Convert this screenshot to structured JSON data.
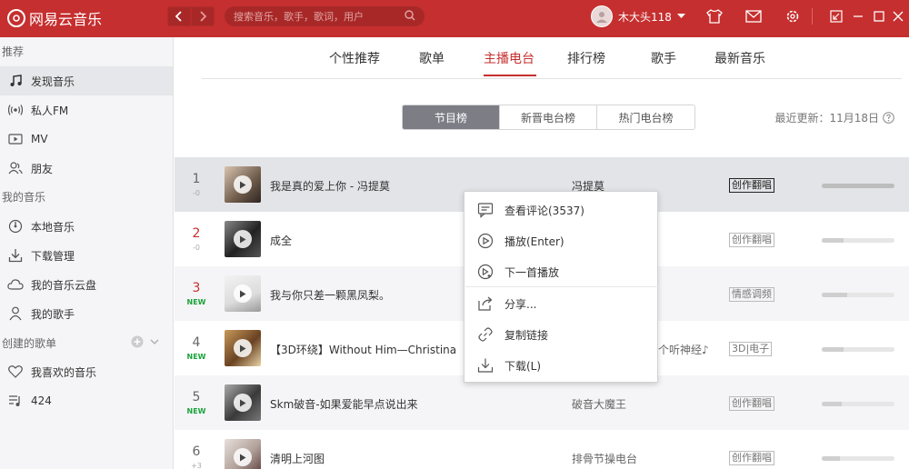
{
  "app": {
    "logo_text": "网易云音乐"
  },
  "search": {
    "placeholder": "搜索音乐，歌手，歌词，用户"
  },
  "user": {
    "name": "木大头118"
  },
  "sidebar": {
    "section_recommend": "推荐",
    "items_recommend": [
      {
        "label": "发现音乐",
        "icon": "music-note-icon",
        "active": true
      },
      {
        "label": "私人FM",
        "icon": "radio-icon"
      },
      {
        "label": "MV",
        "icon": "video-icon"
      },
      {
        "label": "朋友",
        "icon": "friends-icon"
      }
    ],
    "section_mymusic": "我的音乐",
    "items_mymusic": [
      {
        "label": "本地音乐",
        "icon": "local-music-icon"
      },
      {
        "label": "下载管理",
        "icon": "download-icon"
      },
      {
        "label": "我的音乐云盘",
        "icon": "cloud-icon"
      },
      {
        "label": "我的歌手",
        "icon": "singer-icon"
      }
    ],
    "section_playlists": "创建的歌单",
    "items_playlists": [
      {
        "label": "我喜欢的音乐",
        "icon": "heart-icon"
      },
      {
        "label": "424",
        "icon": "playlist-icon"
      }
    ]
  },
  "tabs": [
    "个性推荐",
    "歌单",
    "主播电台",
    "排行榜",
    "歌手",
    "最新音乐"
  ],
  "active_tab": "主播电台",
  "segments": [
    "节目榜",
    "新晋电台榜",
    "热门电台榜"
  ],
  "active_segment": "节目榜",
  "updated": {
    "label": "最近更新：11月18日"
  },
  "programs": [
    {
      "rank": "1",
      "delta": "-0",
      "title": "我是真的爱上你 - 冯提莫",
      "dj": "冯提莫",
      "category": "创作翻唱",
      "popularity": 1.0
    },
    {
      "rank": "2",
      "delta": "-0",
      "title": "成全",
      "dj": "",
      "category": "创作翻唱",
      "popularity": 0.3
    },
    {
      "rank": "3",
      "delta": "NEW",
      "title": "我与你只差一颗黑凤梨。",
      "dj": "",
      "category": "情感调频",
      "popularity": 0.35
    },
    {
      "rank": "4",
      "delta": "NEW",
      "title": "【3D环绕】Without Him—Christina",
      "dj": "一个听神经♪",
      "category": "3D|电子",
      "popularity": 0.3
    },
    {
      "rank": "5",
      "delta": "NEW",
      "title": "Skm破音-如果爱能早点说出来",
      "dj": "破音大魔王",
      "category": "创作翻唱",
      "popularity": 0.28
    },
    {
      "rank": "6",
      "delta": "+3",
      "title": "清明上河图",
      "dj": "排骨节操电台",
      "category": "创作翻唱",
      "popularity": 0.25
    }
  ],
  "context_menu": [
    {
      "label": "查看评论(3537)",
      "icon": "comment-icon"
    },
    {
      "label": "播放(Enter)",
      "icon": "play-icon"
    },
    {
      "label": "下一首播放",
      "icon": "play-next-icon"
    },
    {
      "label": "分享...",
      "icon": "share-icon"
    },
    {
      "label": "复制链接",
      "icon": "link-icon"
    },
    {
      "label": "下载(L)",
      "icon": "download-icon"
    }
  ],
  "colors": {
    "brand": "#c62f2f",
    "sidebar_bg": "#f5f5f7"
  }
}
